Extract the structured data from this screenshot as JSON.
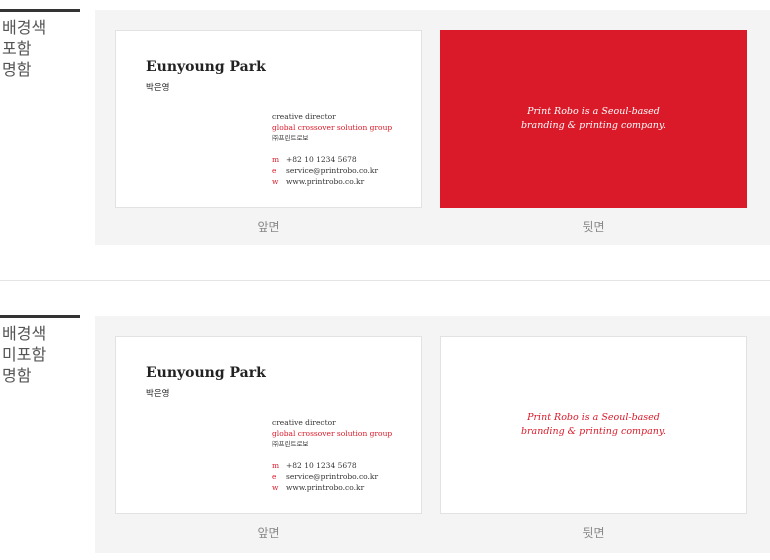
{
  "sections": [
    {
      "label_lines": [
        "배경색",
        "포함",
        "명함"
      ],
      "front": {
        "name": "Eunyoung Park",
        "korean_name": "박은영",
        "title": "creative director",
        "department": "global crossover solution group",
        "company": "㈜프린트로보",
        "contacts": [
          {
            "key": "m",
            "value": "+82 10 1234 5678"
          },
          {
            "key": "e",
            "value": "service@printrobo.co.kr"
          },
          {
            "key": "w",
            "value": "www.printrobo.co.kr"
          }
        ]
      },
      "back": {
        "background": "#da1a29",
        "text_color": "#ffffff",
        "tagline_lines": [
          "Print Robo is a Seoul-based",
          "branding & printing company."
        ]
      },
      "front_caption": "앞면",
      "back_caption": "뒷면"
    },
    {
      "label_lines": [
        "배경색",
        "미포함",
        "명함"
      ],
      "front": {
        "name": "Eunyoung Park",
        "korean_name": "박은영",
        "title": "creative director",
        "department": "global crossover solution group",
        "company": "㈜프린트로보",
        "contacts": [
          {
            "key": "m",
            "value": "+82 10 1234 5678"
          },
          {
            "key": "e",
            "value": "service@printrobo.co.kr"
          },
          {
            "key": "w",
            "value": "www.printrobo.co.kr"
          }
        ]
      },
      "back": {
        "background": "#ffffff",
        "text_color": "#da1a29",
        "tagline_lines": [
          "Print Robo is a Seoul-based",
          "branding & printing company."
        ]
      },
      "front_caption": "앞면",
      "back_caption": "뒷면"
    }
  ],
  "colors": {
    "accent": "#da1a29",
    "panel": "#f4f4f4",
    "label_bar": "#333333"
  }
}
